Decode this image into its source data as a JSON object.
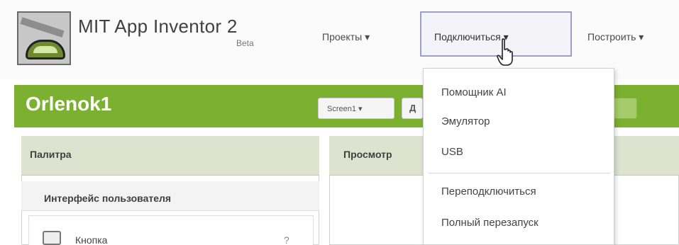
{
  "header": {
    "app_title": "MIT App Inventor 2",
    "app_badge": "Beta",
    "nav": {
      "projects": "Проекты ▾",
      "connect": "Подключиться ▾",
      "build": "Построить ▾"
    }
  },
  "project": {
    "name": "Orlenok1",
    "screen_selector": "Screen1 ▾",
    "add_screen": "Д"
  },
  "palette": {
    "title": "Палитра",
    "category": "Интерфейс пользователя",
    "items": [
      {
        "label": "Кнопка",
        "help": "?"
      }
    ]
  },
  "viewer": {
    "title": "Просмотр"
  },
  "connect_menu": {
    "items": [
      "Помощник AI",
      "Эмулятор",
      "USB",
      "Переподключиться",
      "Полный перезапуск"
    ]
  },
  "colors": {
    "accent_green": "#7bb031",
    "panel_header": "#dde3cf",
    "highlight_border": "#9aa0c8"
  },
  "icons": {
    "logo": "app-inventor-logo-icon",
    "cursor": "hand-pointer-icon",
    "button": "button-component-icon",
    "help": "help-icon"
  }
}
